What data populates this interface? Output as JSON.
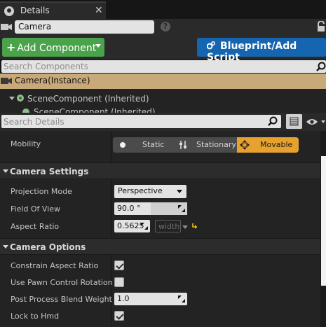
{
  "tab": {
    "title": "Details"
  },
  "actor": {
    "name": "Camera"
  },
  "buttons": {
    "add_component": "Add Component",
    "blueprint": "Blueprint/Add Script"
  },
  "component_search": {
    "placeholder": "Search Components"
  },
  "tree": {
    "instance": "Camera(Instance)",
    "scene": "SceneComponent (Inherited)",
    "cut": "SceneComponent (Inherited)"
  },
  "details_search": {
    "placeholder": "Search Details"
  },
  "mobility": {
    "label": "Mobility",
    "options": [
      "Static",
      "Stationary",
      "Movable"
    ],
    "selected": "Movable"
  },
  "camera_settings": {
    "title": "Camera Settings",
    "projection_mode_label": "Projection Mode",
    "projection_mode_value": "Perspective",
    "fov_label": "Field Of View",
    "fov_value": "90.0 °",
    "aspect_label": "Aspect Ratio",
    "aspect_value": "0.5625",
    "aspect_width": "width"
  },
  "camera_options": {
    "title": "Camera Options",
    "constrain_label": "Constrain Aspect Ratio",
    "constrain_checked": true,
    "pawn_label": "Use Pawn Control Rotation",
    "pawn_checked": false,
    "blend_label": "Post Process Blend Weight",
    "blend_value": "1.0",
    "hmd_label": "Lock to Hmd",
    "hmd_checked": true
  },
  "colors": {
    "add_green": "#4aa34a",
    "blueprint_blue": "#1565b0",
    "movable_orange": "#e7a12e",
    "selection_tan": "#c8a97a"
  }
}
